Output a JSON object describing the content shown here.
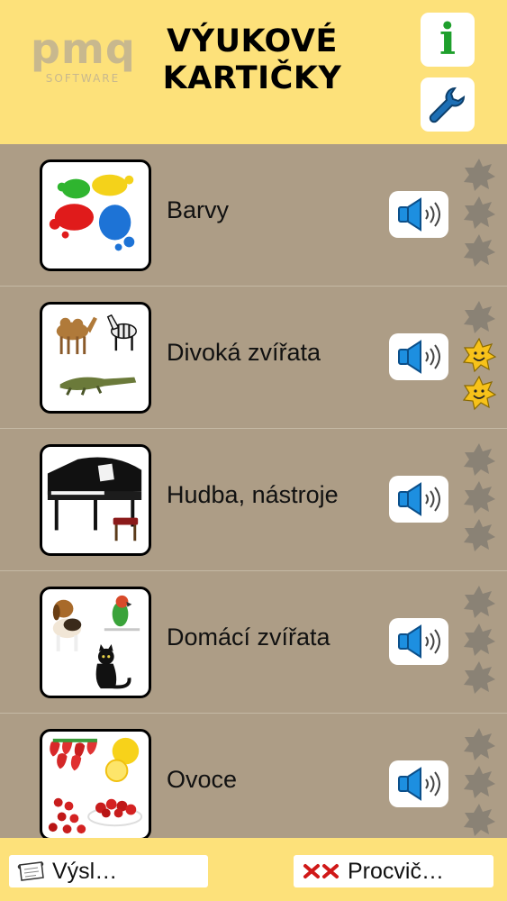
{
  "header": {
    "logo_text": "pmq",
    "logo_subtitle": "SOFTWARE",
    "title_line1": "VÝUKOVÉ",
    "title_line2": "KARTIČKY",
    "info_label": "i"
  },
  "categories": [
    {
      "label": "Barvy",
      "stars": [
        "grey",
        "grey",
        "grey"
      ]
    },
    {
      "label": "Divoká zvířata",
      "stars": [
        "grey",
        "gold",
        "gold"
      ]
    },
    {
      "label": "Hudba, nástroje",
      "stars": [
        "grey",
        "grey",
        "grey"
      ]
    },
    {
      "label": "Domácí zvířata",
      "stars": [
        "grey",
        "grey",
        "grey"
      ]
    },
    {
      "label": "Ovoce",
      "stars": [
        "grey",
        "grey",
        "grey"
      ]
    }
  ],
  "footer": {
    "results_label": "Výsl…",
    "practice_label": "Procvič…"
  },
  "colors": {
    "header_bg": "#fde17a",
    "list_bg": "#ad9d86",
    "speaker_blue": "#1d8fe0",
    "star_grey": "#8a8275",
    "star_gold": "#f7c21a",
    "info_green": "#1e9f2c",
    "wrench_blue": "#1d6fb5"
  },
  "icons": {
    "info": "info-icon",
    "settings": "wrench-icon",
    "sound": "speaker-icon",
    "star": "star-icon",
    "results": "scroll-icon",
    "practice": "cross-marks-icon"
  }
}
